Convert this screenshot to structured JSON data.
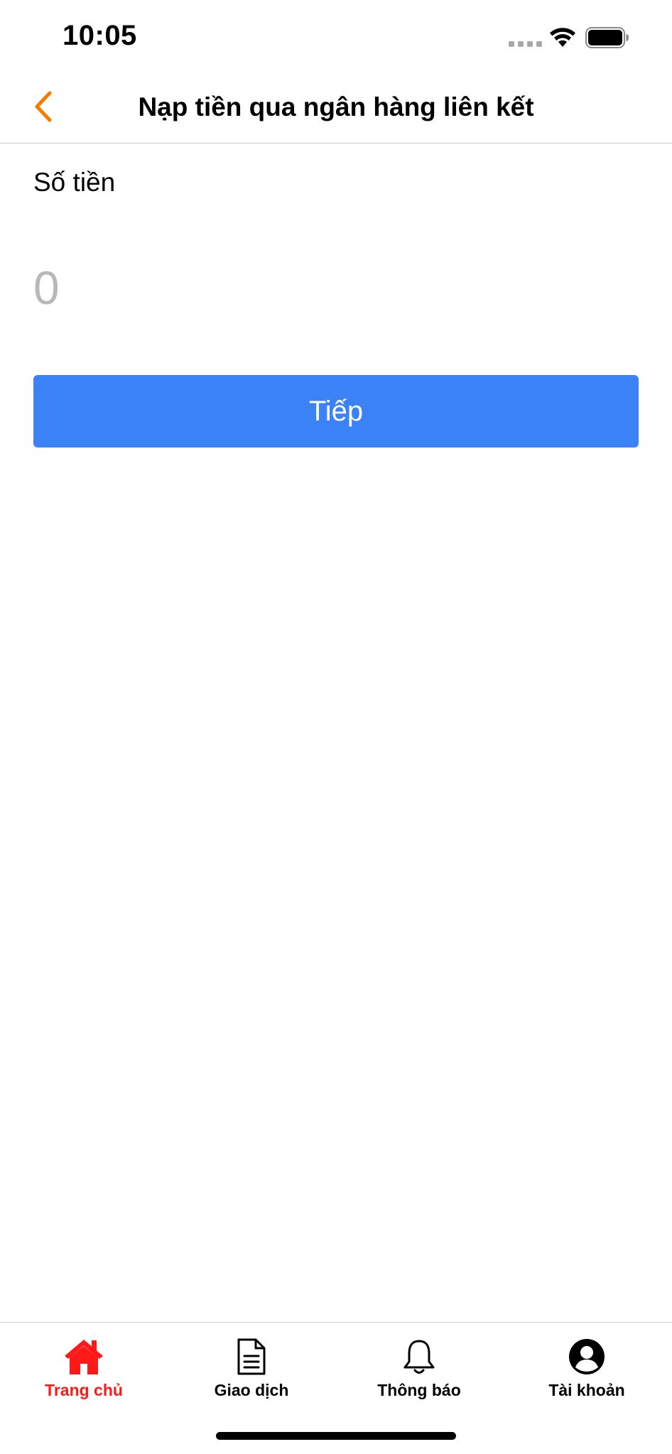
{
  "status_bar": {
    "time": "10:05"
  },
  "header": {
    "title": "Nạp tiền qua ngân hàng liên kết",
    "back_icon": "chevron-left-icon",
    "accent_color": "#f57c00"
  },
  "form": {
    "amount_label": "Số tiền",
    "amount_value": "",
    "amount_placeholder": "0",
    "submit_label": "Tiếp",
    "button_color": "#3b82f6"
  },
  "tab_bar": {
    "active_color": "#ff1a1a",
    "items": [
      {
        "label": "Trang chủ",
        "icon": "home-icon",
        "active": true
      },
      {
        "label": "Giao dịch",
        "icon": "document-icon",
        "active": false
      },
      {
        "label": "Thông báo",
        "icon": "bell-icon",
        "active": false
      },
      {
        "label": "Tài khoản",
        "icon": "account-icon",
        "active": false
      }
    ]
  }
}
